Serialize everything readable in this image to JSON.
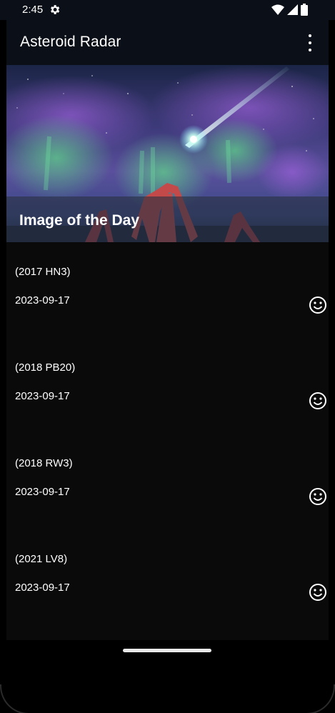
{
  "status_bar": {
    "time": "2:45",
    "icons": [
      "settings-gear-icon",
      "wifi-icon",
      "signal-icon",
      "battery-icon"
    ]
  },
  "app_bar": {
    "title": "Asteroid Radar",
    "overflow_icon": "more-vert-icon"
  },
  "hero": {
    "caption": "Image of the Day",
    "image_description": "aurora-meteor-stone-arch"
  },
  "asteroids": [
    {
      "code": "(2017 HN3)",
      "date": "2023-09-17",
      "status_icon": "smiley-icon"
    },
    {
      "code": "(2018 PB20)",
      "date": "2023-09-17",
      "status_icon": "smiley-icon"
    },
    {
      "code": "(2018 RW3)",
      "date": "2023-09-17",
      "status_icon": "smiley-icon"
    },
    {
      "code": "(2021 LV8)",
      "date": "2023-09-17",
      "status_icon": "smiley-icon"
    }
  ],
  "colors": {
    "app_bar": "#0b0f17",
    "list_background": "#0a0a0a",
    "text": "#ffffff"
  }
}
